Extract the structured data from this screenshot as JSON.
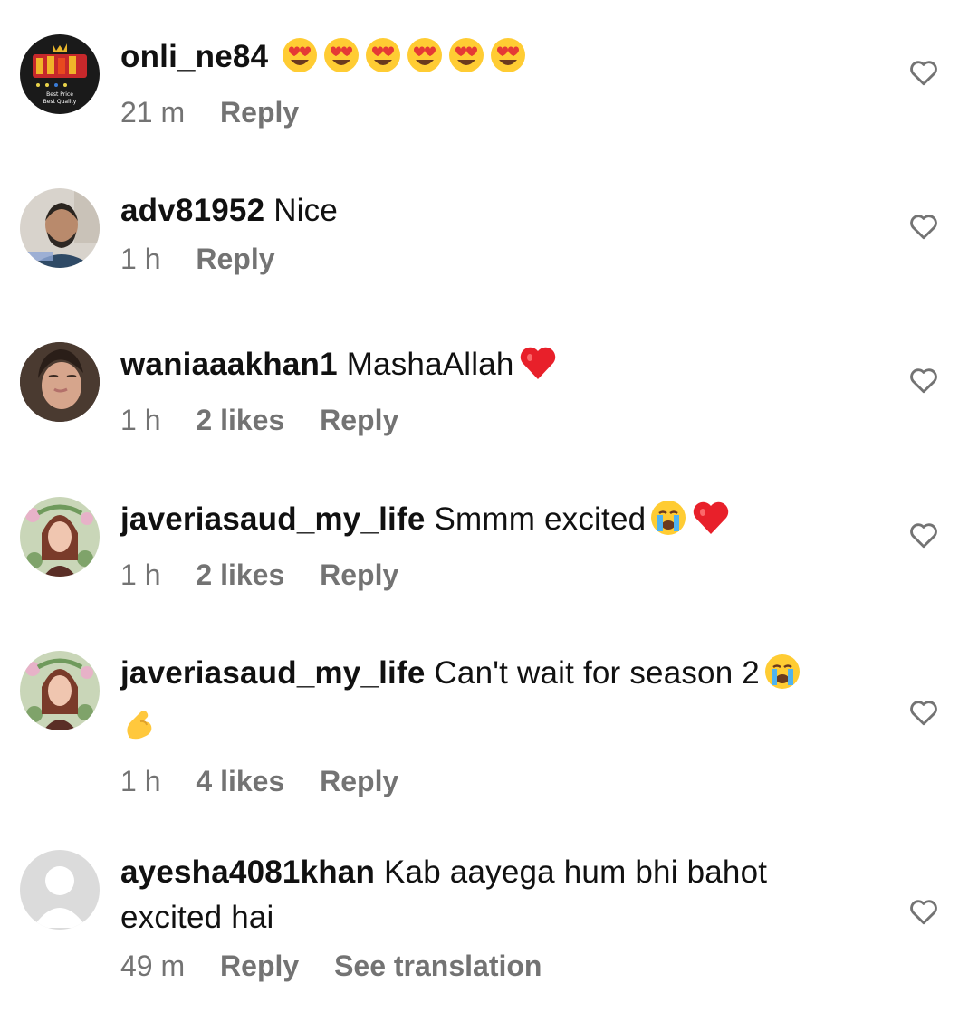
{
  "comments": [
    {
      "username": "onli_ne84",
      "text": "",
      "emojis": [
        "heart-eyes",
        "heart-eyes",
        "heart-eyes",
        "heart-eyes",
        "heart-eyes",
        "heart-eyes"
      ],
      "time": "21 m",
      "likes": "",
      "reply_label": "Reply",
      "translate_label": "",
      "avatar_text": [
        "Best Price",
        "Best Quality"
      ]
    },
    {
      "username": "adv81952",
      "text": "Nice",
      "emojis": [],
      "time": "1 h",
      "likes": "",
      "reply_label": "Reply",
      "translate_label": ""
    },
    {
      "username": "waniaaakhan1",
      "text": "MashaAllah",
      "emojis": [
        "red-heart"
      ],
      "time": "1 h",
      "likes": "2 likes",
      "reply_label": "Reply",
      "translate_label": ""
    },
    {
      "username": "javeriasaud_my_life",
      "text": "Smmm excited",
      "emojis": [
        "crying-face",
        "red-heart"
      ],
      "time": "1 h",
      "likes": "2 likes",
      "reply_label": "Reply",
      "translate_label": ""
    },
    {
      "username": "javeriasaud_my_life",
      "text": "Can't wait for season 2",
      "emojis": [
        "crying-face",
        "pinching-hand"
      ],
      "time": "1 h",
      "likes": "4 likes",
      "reply_label": "Reply",
      "translate_label": ""
    },
    {
      "username": "ayesha4081khan",
      "text": "Kab aayega hum bhi bahot excited hai",
      "emojis": [],
      "time": "49 m",
      "likes": "",
      "reply_label": "Reply",
      "translate_label": "See translation"
    }
  ],
  "icons": {
    "like": "heart-outline-icon"
  },
  "colors": {
    "meta_text": "#737373",
    "username": "#111111",
    "heart_outline": "#737373"
  }
}
